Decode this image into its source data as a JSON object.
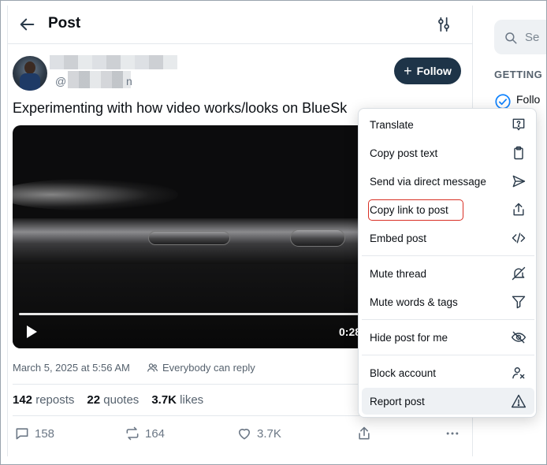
{
  "header": {
    "title": "Post"
  },
  "author": {
    "handle_prefix": "@",
    "handle_suffix": "n"
  },
  "follow_label": "Follow",
  "post": {
    "text": "Experimenting with how video works/looks on BlueSk"
  },
  "video": {
    "time": "0:28",
    "progress": 1.0
  },
  "meta": {
    "date": "March 5, 2025 at 5:56 AM",
    "reply_setting": "Everybody can reply"
  },
  "stats": {
    "reposts_count": "142",
    "reposts_label": "reposts",
    "quotes_count": "22",
    "quotes_label": "quotes",
    "likes_count": "3.7K",
    "likes_label": "likes"
  },
  "actions": {
    "replies": "158",
    "reposts": "164",
    "likes": "3.7K"
  },
  "sidebar": {
    "search_placeholder": "Se",
    "section_title": "GETTING",
    "task_label": "Follo"
  },
  "menu": {
    "items": [
      {
        "label": "Translate",
        "icon": "translate-icon"
      },
      {
        "label": "Copy post text",
        "icon": "clipboard-icon"
      },
      {
        "label": "Send via direct message",
        "icon": "send-icon"
      },
      {
        "label": "Copy link to post",
        "icon": "share-icon"
      },
      {
        "label": "Embed post",
        "icon": "code-icon"
      },
      {
        "label": "Mute thread",
        "icon": "mute-thread-icon"
      },
      {
        "label": "Mute words & tags",
        "icon": "filter-icon"
      },
      {
        "label": "Hide post for me",
        "icon": "eye-off-icon"
      },
      {
        "label": "Block account",
        "icon": "block-user-icon"
      },
      {
        "label": "Report post",
        "icon": "warning-icon"
      }
    ]
  },
  "colors": {
    "follow_bg": "#1e3448",
    "accent": "#1083fe",
    "highlight": "#d93025"
  }
}
